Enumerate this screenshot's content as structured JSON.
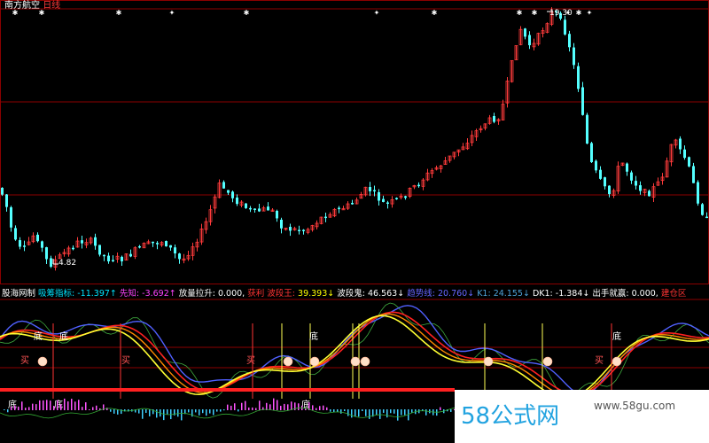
{
  "header": {
    "stock_name": "南方航空",
    "period": "日线"
  },
  "price_panel": {
    "high_label": "19.30",
    "low_label": "4.82"
  },
  "indicator_bar": {
    "name": "股海网制",
    "items": [
      {
        "label": "吸筹指标:",
        "value": "-11.397↑",
        "label_color": "#00e5ff",
        "value_color": "#00e5ff"
      },
      {
        "label": "先知:",
        "value": "-3.692↑",
        "label_color": "#ff44ff",
        "value_color": "#ff44ff"
      },
      {
        "label": "放量拉升:",
        "value": "0.000,",
        "label_color": "#ffffff",
        "value_color": "#ffffff"
      },
      {
        "label": "获利",
        "value": "",
        "label_color": "#ff3333",
        "value_color": "#ff3333"
      },
      {
        "label": "波段王:",
        "value": "39.393↓",
        "label_color": "#ff3333",
        "value_color": "#ffff00"
      },
      {
        "label": "波段鬼:",
        "value": "46.563↓",
        "label_color": "#ffffff",
        "value_color": "#ffffff"
      },
      {
        "label": "趋势线:",
        "value": "20.760↓",
        "label_color": "#6666ff",
        "value_color": "#6666ff"
      },
      {
        "label": "K1:",
        "value": "24.155↓",
        "label_color": "#4fa3d9",
        "value_color": "#4fa3d9"
      },
      {
        "label": "DK1:",
        "value": "-1.384↓",
        "label_color": "#ffffff",
        "value_color": "#ffffff"
      },
      {
        "label": "出手就赢:",
        "value": "0.000,",
        "label_color": "#ffffff",
        "value_color": "#ffffff"
      },
      {
        "label": "建仓区",
        "value": "",
        "label_color": "#ff3333",
        "value_color": "#ff3333"
      }
    ]
  },
  "signal_labels": {
    "top": "底",
    "buy": "买",
    "bottom": "底"
  },
  "watermark": {
    "text": "58公式网",
    "url": "www.58gu.com"
  },
  "colors": {
    "up": "#ff3b3b",
    "down": "#54ffff",
    "grid": "#8b0000",
    "yellow": "#ffff33",
    "red_line": "#ff2020",
    "orange": "#ff8800",
    "blue": "#5060ff",
    "green": "#3faa3f"
  },
  "chart_data": {
    "type": "candlestick",
    "y_low": 4.82,
    "y_high": 19.3,
    "candles_count": 160,
    "indicators": [
      "吸筹指标",
      "先知",
      "放量拉升",
      "波段王",
      "波段鬼",
      "趋势线",
      "K1",
      "DK1",
      "出手就赢"
    ]
  }
}
